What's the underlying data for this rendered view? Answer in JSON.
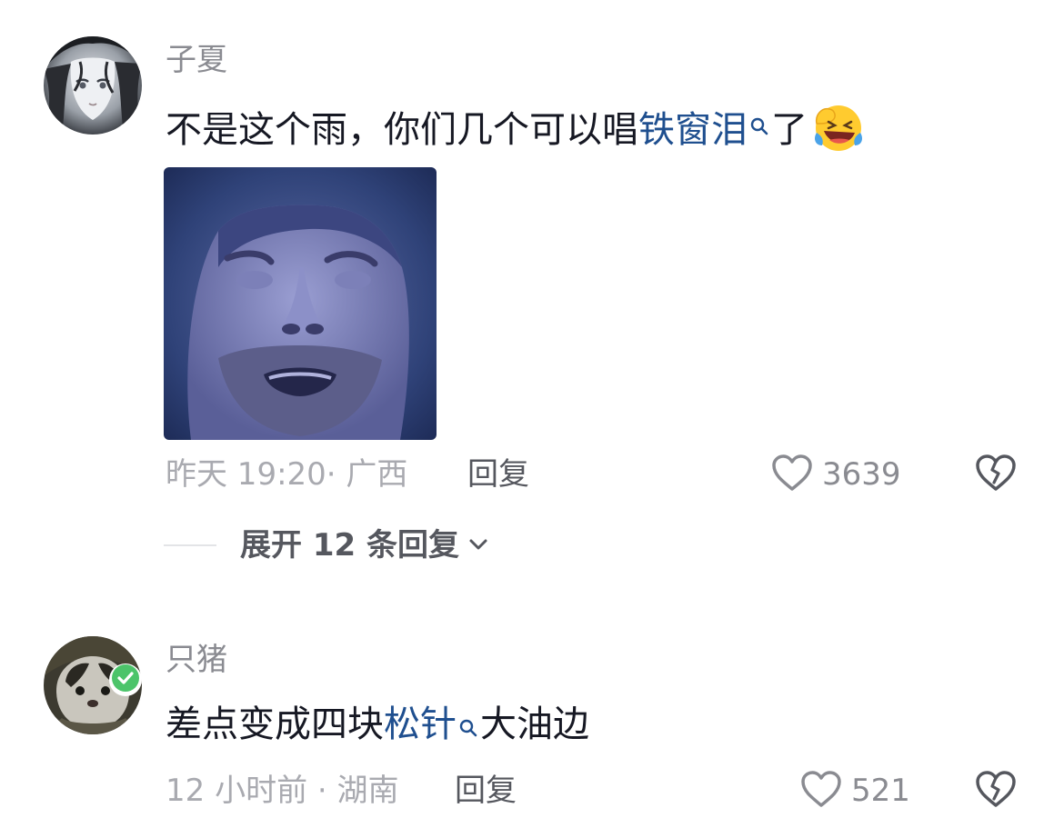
{
  "comments": [
    {
      "username": "子夏",
      "text_before": "不是这个雨，你们几个可以唱",
      "link_text": "铁窗泪",
      "text_after": "了",
      "emoji_icon": "laughing-crying-emoji-icon",
      "has_sticker": true,
      "time": "昨天 19:20· 广西",
      "reply_label": "回复",
      "likes": "3639",
      "expand_label": "展开 12 条回复"
    },
    {
      "username": "只猪",
      "text_before": "差点变成四块",
      "link_text": "松针",
      "text_after": "大油边",
      "verified": true,
      "time": "12 小时前 · 湖南",
      "reply_label": "回复",
      "likes": "521"
    }
  ],
  "colors": {
    "link": "#1f4f8f",
    "meta": "#a9aab0",
    "username": "#8a8b91",
    "text": "#161823",
    "verified_badge": "#4cc46a"
  },
  "icons": {
    "like": "heart-outline-icon",
    "dislike": "broken-heart-icon",
    "search": "search-icon",
    "expand": "chevron-down-icon"
  }
}
